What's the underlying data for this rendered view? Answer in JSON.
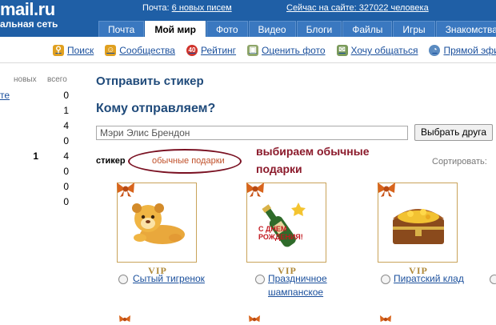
{
  "header": {
    "logo": "mail.ru",
    "logo_sub": "альная сеть",
    "mail_prefix": "Почта: ",
    "mail_link": "6 новых писем",
    "online": "Сейчас на сайте: 327022 человека",
    "tabs": [
      "Почта",
      "Мой мир",
      "Фото",
      "Видео",
      "Блоги",
      "Файлы",
      "Игры",
      "Знакомства"
    ]
  },
  "nav": {
    "items": [
      {
        "label": "Поиск",
        "icon": "search-icon"
      },
      {
        "label": "Сообщества",
        "icon": "community-icon"
      },
      {
        "label": "Рейтинг",
        "icon": "rating-icon"
      },
      {
        "label": "Оценить фото",
        "icon": "rate-photo-icon"
      },
      {
        "label": "Хочу общаться",
        "icon": "chat-icon"
      },
      {
        "label": "Прямой эфи",
        "icon": "live-icon"
      }
    ],
    "rating_badge": "40"
  },
  "left": {
    "col_new": "новых",
    "col_total": "всего",
    "link": "те",
    "new_values": [
      "",
      "",
      "",
      "",
      "1",
      "",
      "",
      ""
    ],
    "total_values": [
      "0",
      "1",
      "4",
      "0",
      "4",
      "0",
      "0",
      "0"
    ]
  },
  "main": {
    "title": "Отправить стикер",
    "subtitle": "Кому отправляем?",
    "recipient": "Мэри Элис Брендон",
    "choose_button": "Выбрать друга",
    "stickers_label": "стикер",
    "category_link": "обычные подарки",
    "annotation": "выбираем обычные подарки",
    "sort_label": "Сортировать:",
    "vip_label": "VIP",
    "greeting_text": "С ДНЕМ РОЖДЕНИЯ!",
    "stickers": [
      {
        "name": "Сытый тигренок",
        "picture": "lion-cub-sticker"
      },
      {
        "name": "Праздничное шампанское",
        "picture": "champagne-sticker"
      },
      {
        "name": "Пиратский клад",
        "picture": "treasure-chest-sticker"
      }
    ]
  },
  "colors": {
    "header_bg": "#1f5fa6",
    "tab_bg": "#3a78c0",
    "link": "#1a4f9c",
    "title": "#1f4a7a",
    "annotation": "#8b1a2b",
    "category_link": "#c0502a",
    "card_border": "#c9a35a"
  }
}
